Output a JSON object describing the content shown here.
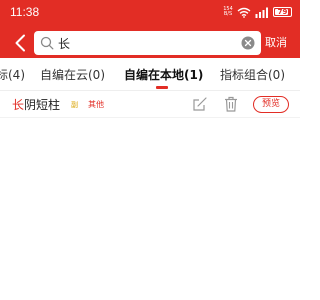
{
  "status_bar": {
    "time": "11:38",
    "net_speed_value": "154",
    "net_speed_unit": "B/S",
    "battery": "79",
    "icons": [
      "net-speed-icon",
      "wifi-icon",
      "signal-icon",
      "battery-icon"
    ]
  },
  "header": {
    "back_icon": "chevron-left-icon",
    "search": {
      "value": "长",
      "placeholder": ""
    },
    "cancel_label": "取消"
  },
  "tabs": [
    {
      "label": "标(4)",
      "active": false
    },
    {
      "label": "自编在云(0)",
      "active": false
    },
    {
      "label": "自编在本地(1)",
      "active": true
    },
    {
      "label": "指标组合(0)",
      "active": false
    }
  ],
  "results": [
    {
      "title_highlight": "长",
      "title_rest": "阴短柱",
      "tag_sub": "副",
      "tag_category": "其他",
      "preview_label": "预览"
    }
  ],
  "colors": {
    "accent": "#e22d25",
    "text": "#222222",
    "icon_gray": "#999999",
    "tag_yellow": "#d9a300"
  }
}
